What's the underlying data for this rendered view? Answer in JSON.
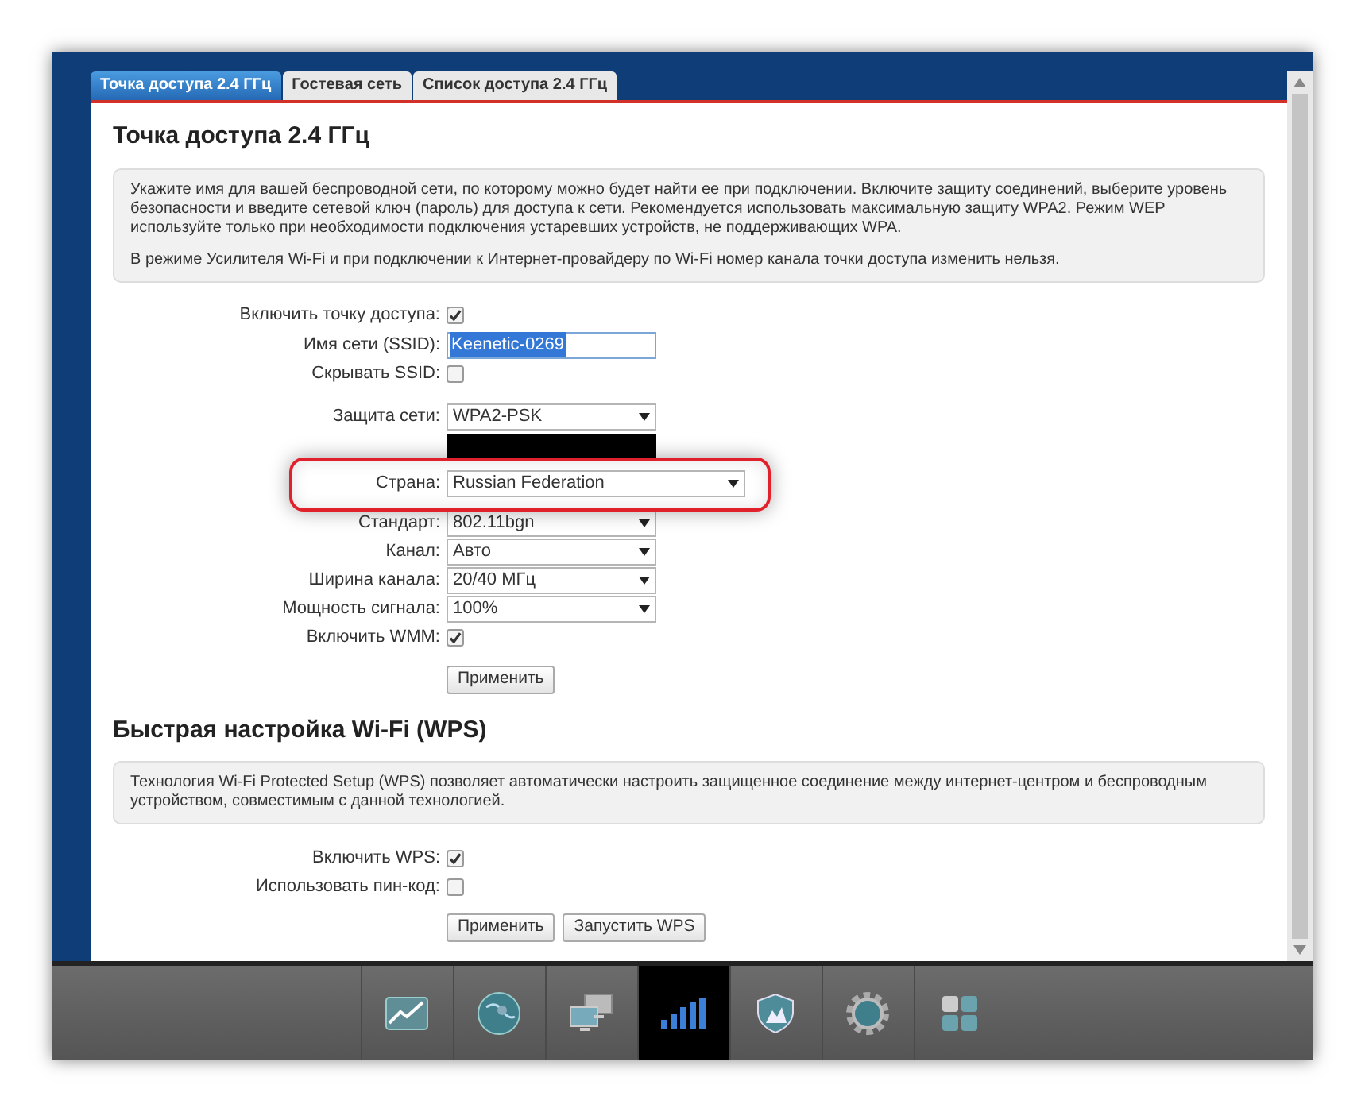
{
  "tabs": [
    {
      "label": "Точка доступа 2.4 ГГц",
      "selected": true
    },
    {
      "label": "Гостевая сеть",
      "selected": false
    },
    {
      "label": "Список доступа 2.4 ГГц",
      "selected": false
    }
  ],
  "sections": [
    {
      "title": "Точка доступа 2.4 ГГц",
      "info": [
        "Укажите имя для вашей беспроводной сети, по которому можно будет найти ее при подключении. Включите защиту соединений, выберите уровень безопасности и введите сетевой ключ (пароль) для доступа к сети. Рекомендуется использовать максимальную защиту WPA2. Режим WEP используйте только при необходимости подключения устаревших устройств, не поддерживающих WPA.",
        "В режиме Усилителя Wi-Fi и при подключении к Интернет-провайдеру по Wi-Fi номер канала точки доступа изменить нельзя."
      ],
      "fields": [
        {
          "kind": "checkbox",
          "label": "Включить точку доступа:",
          "checked": true
        },
        {
          "kind": "text",
          "label": "Имя сети (SSID):",
          "value": "Keenetic-0269",
          "selected": true
        },
        {
          "kind": "checkbox",
          "label": "Скрывать SSID:",
          "checked": false
        },
        {
          "kind": "gap"
        },
        {
          "kind": "select",
          "label": "Защита сети:",
          "value": "WPA2-PSK",
          "highlighted": false
        },
        {
          "kind": "secret"
        },
        {
          "kind": "gap"
        },
        {
          "kind": "select",
          "label": "Страна:",
          "value": "Russian Federation",
          "highlighted": true
        },
        {
          "kind": "select",
          "label": "Стандарт:",
          "value": "802.11bgn",
          "highlighted": false
        },
        {
          "kind": "select",
          "label": "Канал:",
          "value": "Авто",
          "highlighted": false
        },
        {
          "kind": "select",
          "label": "Ширина канала:",
          "value": "20/40 МГц",
          "highlighted": false
        },
        {
          "kind": "select",
          "label": "Мощность сигнала:",
          "value": "100%",
          "highlighted": false
        },
        {
          "kind": "checkbox",
          "label": "Включить WMM:",
          "checked": true
        }
      ],
      "buttons": [
        "Применить"
      ]
    },
    {
      "title": "Быстрая настройка Wi-Fi (WPS)",
      "info": [
        "Технология Wi-Fi Protected Setup (WPS) позволяет автоматически настроить защищенное соединение между интернет-центром и беспроводным устройством, совместимым с данной технологией."
      ],
      "fields": [
        {
          "kind": "checkbox",
          "label": "Включить WPS:",
          "checked": true
        },
        {
          "kind": "checkbox",
          "label": "Использовать пин-код:",
          "checked": false
        }
      ],
      "buttons": [
        "Применить",
        "Запустить WPS"
      ]
    }
  ],
  "dock": [
    {
      "kind": "chart",
      "selected": false
    },
    {
      "kind": "globe",
      "selected": false
    },
    {
      "kind": "network",
      "selected": false
    },
    {
      "kind": "signal",
      "selected": true
    },
    {
      "kind": "shield",
      "selected": false
    },
    {
      "kind": "gear",
      "selected": false
    },
    {
      "kind": "apps",
      "selected": false
    }
  ]
}
